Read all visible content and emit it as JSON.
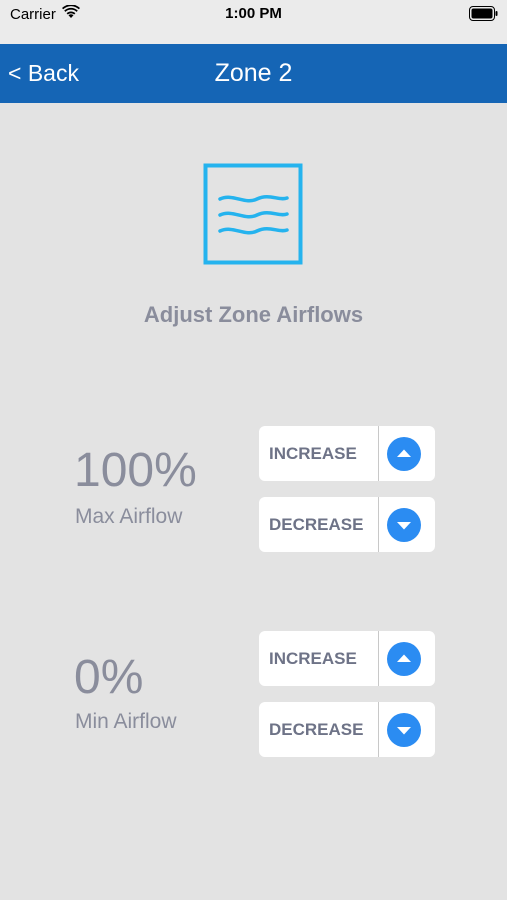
{
  "status_bar": {
    "carrier": "Carrier",
    "time": "1:00 PM"
  },
  "nav": {
    "back_label": "< Back",
    "title": "Zone 2"
  },
  "icon": {
    "name": "airflow-icon",
    "color": "#25b3ee"
  },
  "heading": "Adjust Zone Airflows",
  "max": {
    "value": "100%",
    "label": "Max Airflow",
    "increase_label": "INCREASE",
    "decrease_label": "DECREASE"
  },
  "min": {
    "value": "0%",
    "label": "Min Airflow",
    "increase_label": "INCREASE",
    "decrease_label": "DECREASE"
  },
  "colors": {
    "nav_bar": "#1565b5",
    "accent": "#2b8cf2",
    "background": "#e3e3e3",
    "text_muted": "#8a8d9c"
  }
}
